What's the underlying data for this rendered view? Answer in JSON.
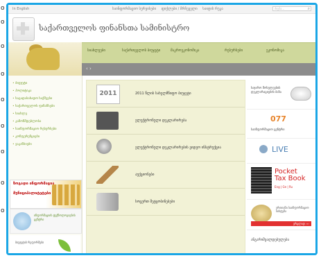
{
  "margin_bullets": [
    "o",
    "o",
    "o",
    "o",
    "o",
    "o",
    "o",
    "o",
    "o"
  ],
  "topbar": {
    "lang_label": "In English",
    "links": [
      "საინფორმაციო სერვისები",
      "ფიქლები / მრჩეველი",
      "საიტის რუკა"
    ],
    "search_placeholder": "ძიება..."
  },
  "header": {
    "title": "საქართველოს ფინანსთა სამინისტრო"
  },
  "nav": {
    "items": [
      "სიახლეები",
      "საქართველოს ბიუჯეტი",
      "მაკროეკონომიკა",
      "რესურსები",
      "ეკონომიკა"
    ]
  },
  "gray_bar": {
    "label": "‹ ›"
  },
  "sidebar": {
    "menu": [
      "ბიუჯეტი",
      "პოლიტიკა",
      "საგადასახადო საქმეები",
      "საქართველოს ფინანსები",
      "სიახლე",
      "კანონმდებლობა",
      "საინფორმაციო რესურსები",
      "კონფერენციები",
      "ვაკანსიები"
    ],
    "promo1_line1": "ზოგადი ინფორმაცია",
    "promo1_line2": "მუნიციპალიტეტები",
    "promo2_text": "ინფორმაციის ტექნოლოგიების ცენტრი",
    "promo3_text": "ბიუჯეტის რეფორმები"
  },
  "main": {
    "rows": [
      {
        "icon": "2011",
        "label": "2011 წლის სახელმწიფო ბიუჯეტი"
      },
      {
        "icon": "laptop-icon",
        "label": "ელექტრონული დეკლარირება"
      },
      {
        "icon": "camera-icon",
        "label": "ელექტრონული დეკლარირების ვიდეო ინსტრუქცია"
      },
      {
        "icon": "gavel-icon",
        "label": "აუქციონები"
      },
      {
        "icon": "speaker-icon",
        "label": "სოცერთ შეტყობინებები"
      }
    ]
  },
  "right": {
    "card1": "საჯარო მოხელეების დეკლარაციების ბაზა",
    "card2_number": "077",
    "card2_text": "საინფორმაციო ცენტრი",
    "card3": "LIVE",
    "card4_title1": "Pocket",
    "card4_title2": "Tax Book",
    "card4_langs": "Eng | Ge | Ru",
    "card5_text": "ერთიანი საინფორმაციო სისტემა",
    "card5_bar": "ვრცლად ›››",
    "card6": "ანგარიშვალდებულება"
  },
  "colors": {
    "frame_border": "#1aa6e6",
    "nav_bg": "#cfd89c",
    "main_bg": "#f2f2d6",
    "accent_red": "#e23030"
  }
}
